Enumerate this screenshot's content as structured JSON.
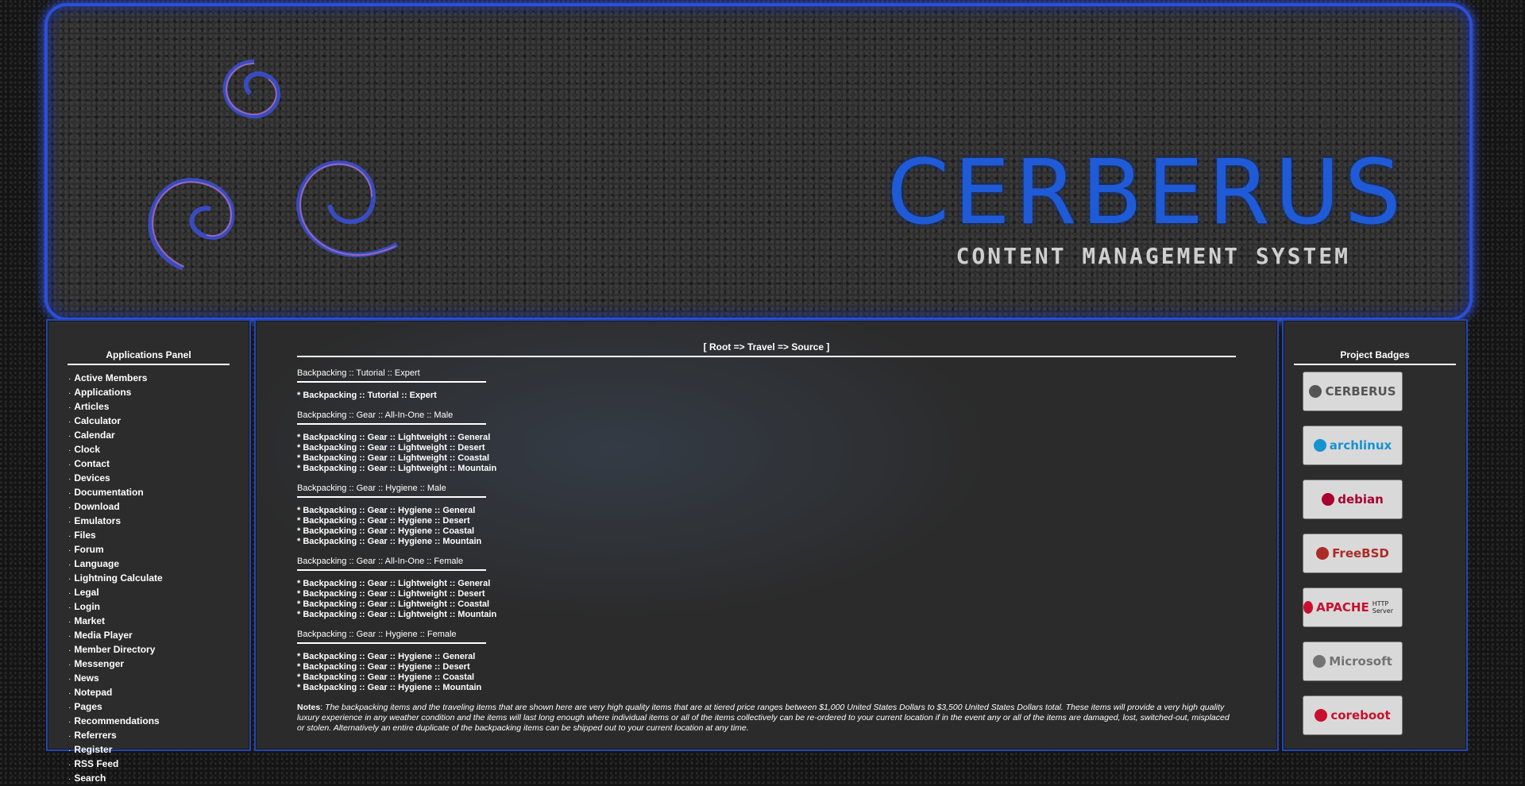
{
  "banner": {
    "brand_title": "CERBERUS",
    "brand_subtitle": "CONTENT MANAGEMENT SYSTEM",
    "accent_color": "#2b4fd8"
  },
  "left_panel": {
    "title": "Applications Panel",
    "items": [
      "Active Members",
      "Applications",
      "Articles",
      "Calculator",
      "Calendar",
      "Clock",
      "Contact",
      "Devices",
      "Documentation",
      "Download",
      "Emulators",
      "Files",
      "Forum",
      "Language",
      "Lightning Calculate",
      "Legal",
      "Login",
      "Market",
      "Media Player",
      "Member Directory",
      "Messenger",
      "News",
      "Notepad",
      "Pages",
      "Recommendations",
      "Referrers",
      "Register",
      "RSS Feed",
      "Search"
    ]
  },
  "center": {
    "breadcrumb": "[ Root => Travel => Source ]",
    "sections": [
      {
        "heading": "Backpacking :: Tutorial :: Expert",
        "items": [
          "* Backpacking :: Tutorial :: Expert"
        ]
      },
      {
        "heading": "Backpacking :: Gear :: All-In-One :: Male",
        "items": [
          "* Backpacking :: Gear :: Lightweight :: General",
          "* Backpacking :: Gear :: Lightweight :: Desert",
          "* Backpacking :: Gear :: Lightweight :: Coastal",
          "* Backpacking :: Gear :: Lightweight :: Mountain"
        ]
      },
      {
        "heading": "Backpacking :: Gear :: Hygiene :: Male",
        "items": [
          "* Backpacking :: Gear :: Hygiene :: General",
          "* Backpacking :: Gear :: Hygiene :: Desert",
          "* Backpacking :: Gear :: Hygiene :: Coastal",
          "* Backpacking :: Gear :: Hygiene :: Mountain"
        ]
      },
      {
        "heading": "Backpacking :: Gear :: All-In-One :: Female",
        "items": [
          "* Backpacking :: Gear :: Lightweight :: General",
          "* Backpacking :: Gear :: Lightweight :: Desert",
          "* Backpacking :: Gear :: Lightweight :: Coastal",
          "* Backpacking :: Gear :: Lightweight :: Mountain"
        ]
      },
      {
        "heading": "Backpacking :: Gear :: Hygiene :: Female",
        "items": [
          "* Backpacking :: Gear :: Hygiene :: General",
          "* Backpacking :: Gear :: Hygiene :: Desert",
          "* Backpacking :: Gear :: Hygiene :: Coastal",
          "* Backpacking :: Gear :: Hygiene :: Mountain"
        ]
      }
    ],
    "notes_label": "Notes",
    "notes_text": "The backpacking items and the traveling items that are shown here are very high quality items that are at tiered price ranges between $1,000 United States Dollars to $3,500 United States Dollars total. These items will provide a very high quality luxury experience in any weather condition and the items will last long enough where individual items or all of the items collectively can be re-ordered to your current location if in the event any or all of the items are damaged, lost, switched-out, misplaced or stolen. Alternatively an entire duplicate of the backpacking items can be shipped out to your current location at any time."
  },
  "right_panel": {
    "title": "Project Badges",
    "badges": [
      {
        "label": "CERBERUS",
        "icon": "cerberus-logo",
        "color": "#555555"
      },
      {
        "label": "archlinux",
        "icon": "arch-logo",
        "color": "#1793d1"
      },
      {
        "label": "debian",
        "icon": "debian-swirl",
        "color": "#a80030"
      },
      {
        "label": "FreeBSD",
        "icon": "beastie-icon",
        "color": "#ab2b28"
      },
      {
        "label": "APACHE",
        "sub": "HTTP Server",
        "icon": "apache-feather",
        "color": "#c8102e"
      },
      {
        "label": "Microsoft",
        "icon": "windows-logo",
        "color": "#737373"
      },
      {
        "label": "coreboot",
        "icon": "coreboot-rabbit",
        "color": "#c8102e"
      }
    ]
  }
}
